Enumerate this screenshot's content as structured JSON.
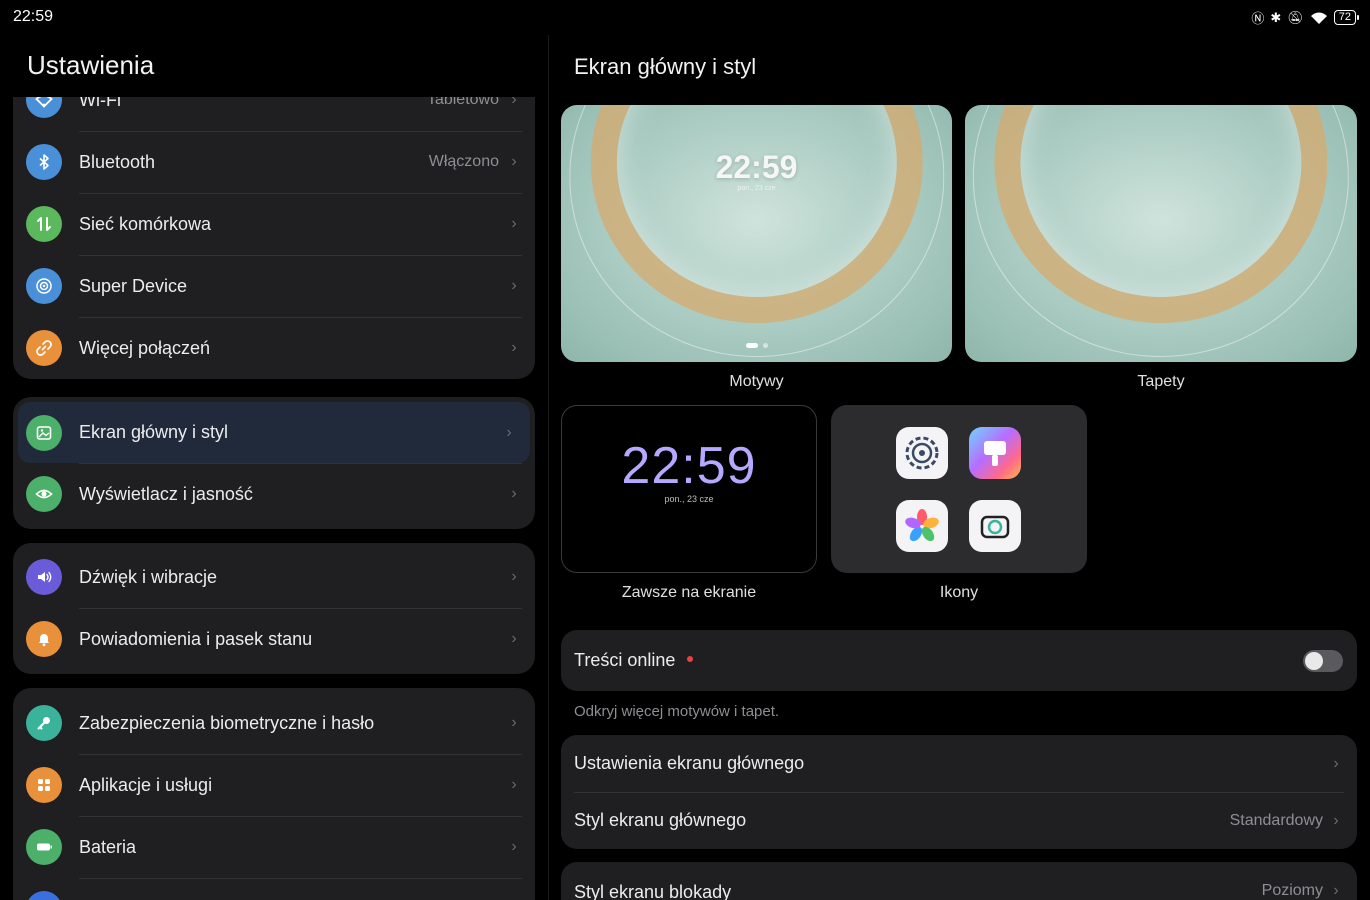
{
  "status_bar": {
    "time": "22:59",
    "battery": "72"
  },
  "left_pane": {
    "title": "Ustawienia",
    "groups": [
      {
        "items": [
          {
            "label": "Wi-Fi",
            "value": "Tabletowo",
            "icon": "wifi-icon",
            "color": "#4a90d9"
          },
          {
            "label": "Bluetooth",
            "value": "Włączono",
            "icon": "bluetooth-icon",
            "color": "#4a90d9"
          },
          {
            "label": "Sieć komórkowa",
            "value": "",
            "icon": "cellular-icon",
            "color": "#5cb85c"
          },
          {
            "label": "Super Device",
            "value": "",
            "icon": "super-device-icon",
            "color": "#4a90d9"
          },
          {
            "label": "Więcej połączeń",
            "value": "",
            "icon": "link-icon",
            "color": "#e8903a"
          }
        ]
      },
      {
        "items": [
          {
            "label": "Ekran główny i styl",
            "value": "",
            "icon": "image-icon",
            "color": "#4caf6a",
            "selected": true
          },
          {
            "label": "Wyświetlacz i jasność",
            "value": "",
            "icon": "eye-icon",
            "color": "#4caf6a"
          }
        ]
      },
      {
        "items": [
          {
            "label": "Dźwięk i wibracje",
            "value": "",
            "icon": "speaker-icon",
            "color": "#6a5cd8"
          },
          {
            "label": "Powiadomienia i pasek stanu",
            "value": "",
            "icon": "bell-icon",
            "color": "#e8903a"
          }
        ]
      },
      {
        "items": [
          {
            "label": "Zabezpieczenia biometryczne i hasło",
            "value": "",
            "icon": "key-icon",
            "color": "#3bb39a"
          },
          {
            "label": "Aplikacje i usługi",
            "value": "",
            "icon": "apps-icon",
            "color": "#e8903a"
          },
          {
            "label": "Bateria",
            "value": "",
            "icon": "battery-icon",
            "color": "#4caf6a"
          }
        ]
      }
    ]
  },
  "right_pane": {
    "title": "Ekran główny i styl",
    "tiles": {
      "themes": {
        "caption": "Motywy",
        "clock": "22:59",
        "date": "pon., 23 cze"
      },
      "wallpapers": {
        "caption": "Tapety"
      },
      "aod": {
        "caption": "Zawsze na ekranie",
        "clock": "22:59",
        "date": "pon., 23 cze"
      },
      "icons": {
        "caption": "Ikony"
      }
    },
    "online_content": {
      "label": "Treści online",
      "enabled": false,
      "hint": "Odkryj więcej motywów i tapet."
    },
    "home_card": {
      "settings_label": "Ustawienia ekranu głównego",
      "style_label": "Styl ekranu głównego",
      "style_value": "Standardowy"
    },
    "lock_card": {
      "label": "Styl ekranu blokady",
      "value": "Poziomy"
    }
  }
}
